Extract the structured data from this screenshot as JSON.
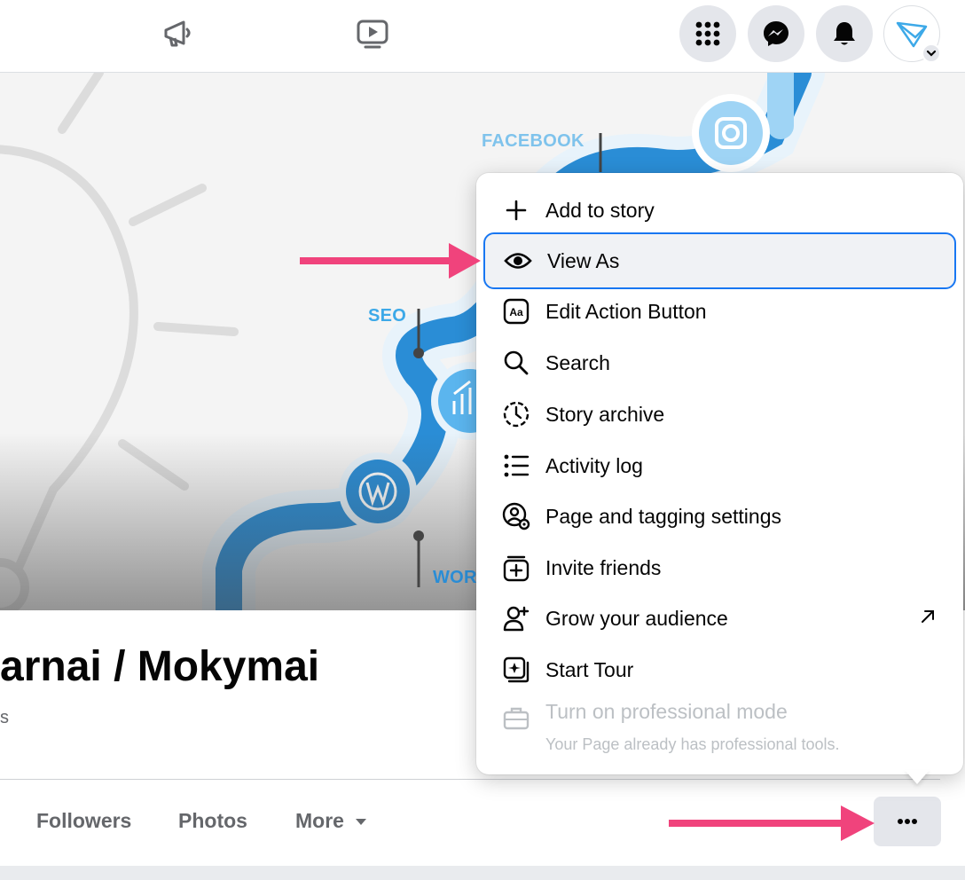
{
  "topbar": {
    "icons": [
      "megaphone-icon",
      "video-icon",
      "apps-grid-icon",
      "messenger-icon",
      "bell-icon",
      "avatar"
    ]
  },
  "cover": {
    "labels": {
      "facebook": "FACEBOOK",
      "seo": "SEO",
      "wordpress_partial": "WOR"
    }
  },
  "profile": {
    "page_name": "arnai / Mokymai",
    "sub_text": "s"
  },
  "tabs": [
    {
      "label": "Followers"
    },
    {
      "label": "Photos"
    },
    {
      "label": "More"
    }
  ],
  "menu": {
    "items": [
      {
        "label": "Add to story",
        "icon": "plus-icon"
      },
      {
        "label": "View As",
        "icon": "eye-icon"
      },
      {
        "label": "Edit Action Button",
        "icon": "edit-action-icon"
      },
      {
        "label": "Search",
        "icon": "search-icon"
      },
      {
        "label": "Story archive",
        "icon": "archive-clock-icon"
      },
      {
        "label": "Activity log",
        "icon": "list-icon"
      },
      {
        "label": "Page and tagging settings",
        "icon": "gear-person-icon"
      },
      {
        "label": "Invite friends",
        "icon": "invite-icon"
      },
      {
        "label": "Grow your audience",
        "icon": "add-person-icon"
      },
      {
        "label": "Start Tour",
        "icon": "tour-icon"
      },
      {
        "label": "Turn on professional mode",
        "icon": "briefcase-icon",
        "description": "Your Page already has professional tools."
      }
    ]
  },
  "colors": {
    "accent_blue": "#1877f2",
    "annotation_arrow": "#f0437c",
    "cover_blue": "#3da9e8"
  }
}
